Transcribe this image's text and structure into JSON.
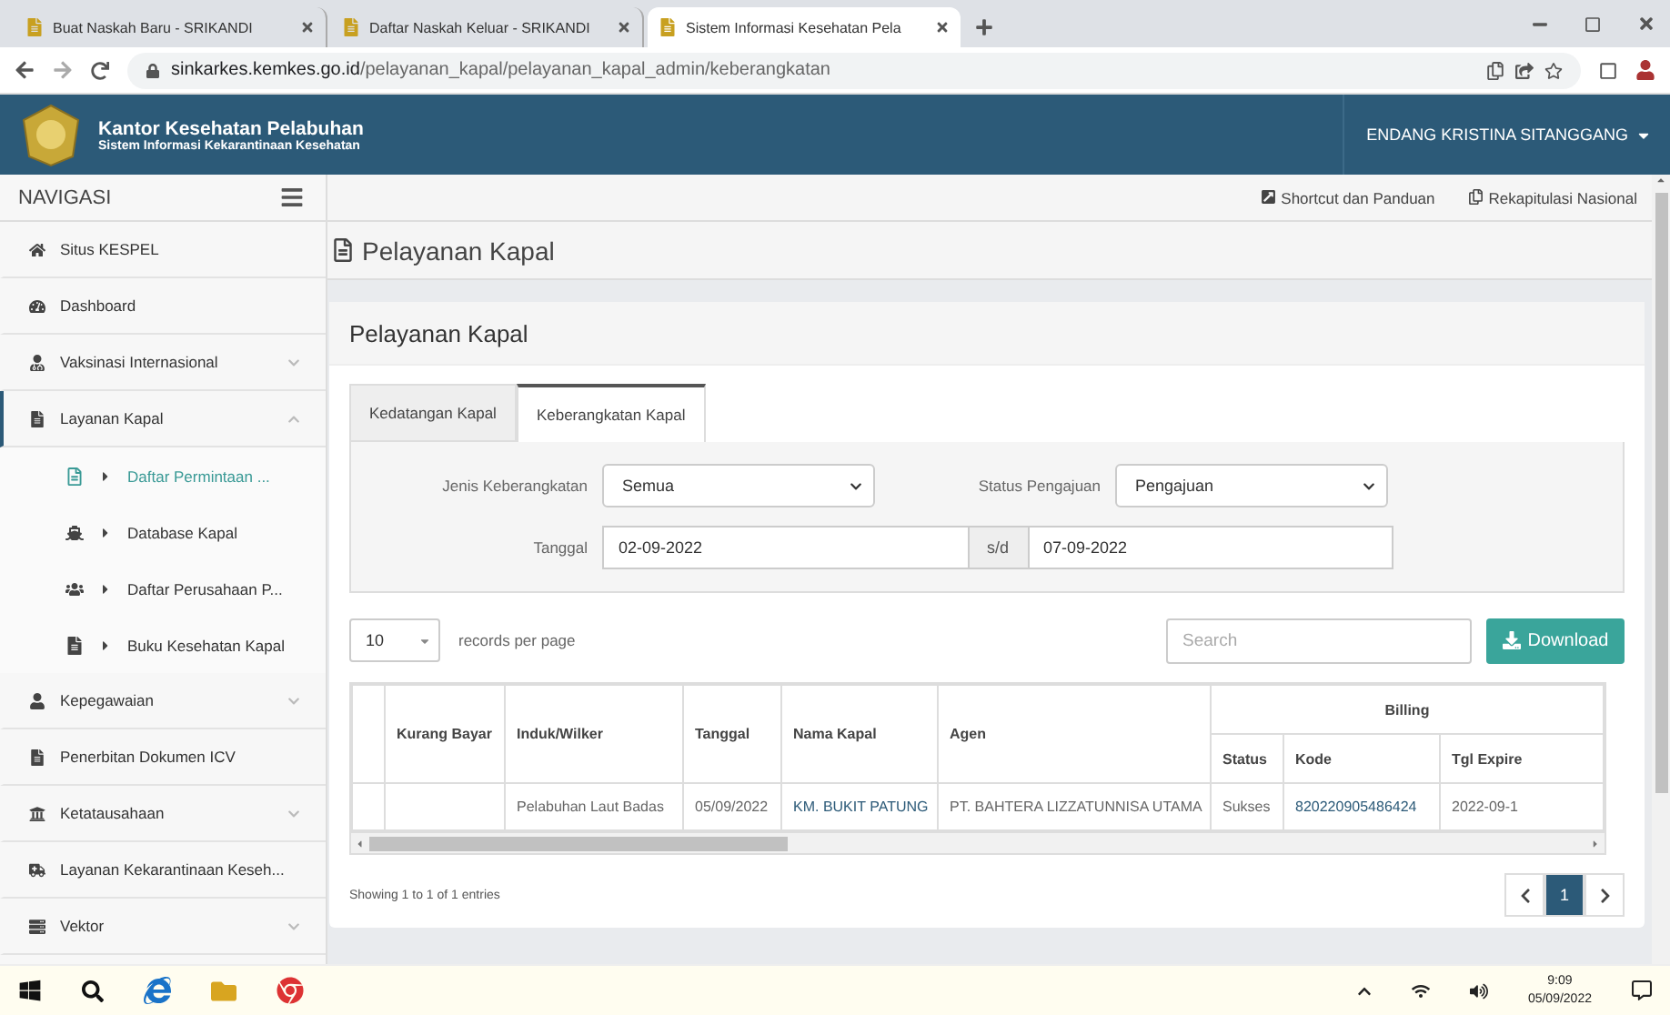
{
  "browser": {
    "tabs": [
      {
        "title": "Buat Naskah Baru - SRIKANDI",
        "selected": false
      },
      {
        "title": "Daftar Naskah Keluar - SRIKANDI",
        "selected": false
      },
      {
        "title": "Sistem Informasi Kesehatan Pela",
        "selected": true
      }
    ],
    "url": {
      "host": "sinkarkes.kemkes.go.id",
      "path": "/pelayanan_kapal/pelayanan_kapal_admin/keberangkatan"
    }
  },
  "header": {
    "title": "Kantor Kesehatan Pelabuhan",
    "subtitle": "Sistem Informasi Kekarantinaan Kesehatan",
    "user": "ENDANG KRISTINA SITANGGANG"
  },
  "sidebar": {
    "heading": "NAVIGASI",
    "items": [
      {
        "label": "Situs KESPEL",
        "kind": "link"
      },
      {
        "label": "Dashboard",
        "kind": "link"
      },
      {
        "label": "Vaksinasi Internasional",
        "kind": "group",
        "expanded": false
      },
      {
        "label": "Layanan Kapal",
        "kind": "group",
        "expanded": true,
        "children": [
          {
            "label": "Daftar Permintaan ...",
            "selected": true
          },
          {
            "label": "Database Kapal",
            "selected": false
          },
          {
            "label": "Daftar Perusahaan P...",
            "selected": false
          },
          {
            "label": "Buku Kesehatan Kapal",
            "selected": false
          }
        ]
      },
      {
        "label": "Kepegawaian",
        "kind": "group",
        "expanded": false
      },
      {
        "label": "Penerbitan Dokumen ICV",
        "kind": "link"
      },
      {
        "label": "Ketatausahaan",
        "kind": "group",
        "expanded": false
      },
      {
        "label": "Layanan Kekarantinaan Keseh...",
        "kind": "link"
      },
      {
        "label": "Vektor",
        "kind": "group",
        "expanded": false
      }
    ]
  },
  "topbar_links": [
    "Shortcut dan Panduan",
    "Rekapitulasi Nasional"
  ],
  "page_title": "Pelayanan Kapal",
  "panel": {
    "title": "Pelayanan Kapal",
    "tabs": [
      {
        "label": "Kedatangan Kapal",
        "selected": false
      },
      {
        "label": "Keberangkatan Kapal",
        "selected": true
      }
    ],
    "filters": {
      "jenis_label": "Jenis Keberangkatan",
      "jenis_value": "Semua",
      "status_label": "Status Pengajuan",
      "status_value": "Pengajuan",
      "tanggal_label": "Tanggal",
      "date_from": "02-09-2022",
      "range_sep": "s/d",
      "date_to": "07-09-2022"
    },
    "page_size": "10",
    "page_size_label": "records per page",
    "search_placeholder": "Search",
    "download": "Download",
    "table": {
      "columns": [
        "",
        "Kurang Bayar",
        "Induk/Wilker",
        "Tanggal",
        "Nama Kapal",
        "Agen"
      ],
      "group_header": "Billing",
      "sub_columns": [
        "Status",
        "Kode",
        "Tgl Expire"
      ],
      "rows": [
        {
          "cells": [
            "",
            "",
            "Pelabuhan Laut Badas",
            "05/09/2022",
            "KM. BUKIT PATUNG",
            "PT. BAHTERA LIZZATUNNISA UTAMA",
            "Sukses",
            "820220905486424",
            "2022-09-1"
          ]
        }
      ]
    },
    "info": "Showing 1 to 1 of 1 entries",
    "pages": [
      {
        "label": "1",
        "selected": true
      }
    ]
  },
  "taskbar": {
    "time": "9:09",
    "date": "05/09/2022"
  }
}
